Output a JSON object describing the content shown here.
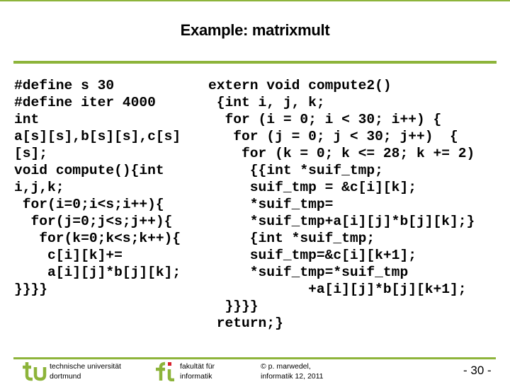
{
  "slide": {
    "title": "Example: matrixmult",
    "accent_color": "#8db43a",
    "left_code": [
      "#define s 30",
      "#define iter 4000",
      "int",
      "a[s][s],b[s][s],c[s]",
      "[s];",
      "void compute(){int",
      "i,j,k;",
      " for(i=0;i<s;i++){",
      "  for(j=0;j<s;j++){",
      "   for(k=0;k<s;k++){",
      "    c[i][k]+=",
      "    a[i][j]*b[j][k];",
      "}}}}"
    ],
    "right_code": [
      "extern void compute2()",
      " {int i, j, k;",
      "  for (i = 0; i < 30; i++) {",
      "   for (j = 0; j < 30; j++)  {",
      "    for (k = 0; k <= 28; k += 2)",
      "     {{int *suif_tmp;",
      "     suif_tmp = &c[i][k];",
      "     *suif_tmp=",
      "     *suif_tmp+a[i][j]*b[j][k];}",
      "     {int *suif_tmp;",
      "     suif_tmp=&c[i][k+1];",
      "     *suif_tmp=*suif_tmp",
      "            +a[i][j]*b[j][k+1];",
      "  }}}}",
      " return;}"
    ]
  },
  "footer": {
    "university_line1": "technische universität",
    "university_line2": "dortmund",
    "faculty_line1": "fakultät für",
    "faculty_line2": "informatik",
    "copyright_line1": "© p. marwedel,",
    "copyright_line2": "informatik 12,  2011",
    "page_number": "-  30 -",
    "tu_logo_icon": "tu-logo",
    "fi_logo_icon": "fi-logo",
    "logo_color": "#8db43a",
    "fi_dot_color": "#d7212e"
  }
}
